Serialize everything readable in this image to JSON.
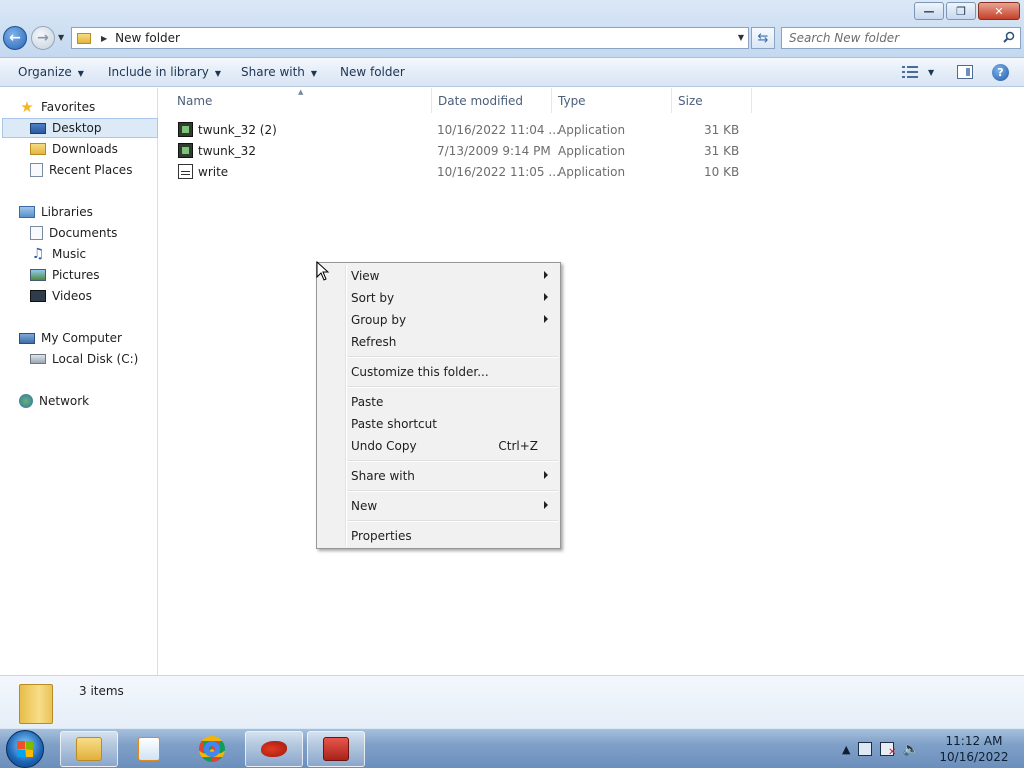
{
  "window": {
    "minimize_glyph": "—",
    "maximize_glyph": "❐",
    "close_glyph": "✕"
  },
  "address": {
    "path": "New folder",
    "search_placeholder": "Search New folder"
  },
  "toolbar": {
    "organize": "Organize",
    "include_in_library": "Include in library",
    "share_with": "Share with",
    "new_folder": "New folder",
    "help": "?"
  },
  "navpane": {
    "favorites": "Favorites",
    "desktop": "Desktop",
    "downloads": "Downloads",
    "recent_places": "Recent Places",
    "libraries": "Libraries",
    "documents": "Documents",
    "music": "Music",
    "pictures": "Pictures",
    "videos": "Videos",
    "my_computer": "My Computer",
    "local_disk": "Local Disk (C:)",
    "network": "Network"
  },
  "columns": {
    "name": "Name",
    "date_modified": "Date modified",
    "type": "Type",
    "size": "Size"
  },
  "files": [
    {
      "name": "twunk_32 (2)",
      "date": "10/16/2022 11:04 ...",
      "type": "Application",
      "size": "31 KB",
      "icon": "application-icon"
    },
    {
      "name": "twunk_32",
      "date": "7/13/2009 9:14 PM",
      "type": "Application",
      "size": "31 KB",
      "icon": "application-icon"
    },
    {
      "name": "write",
      "date": "10/16/2022 11:05 ...",
      "type": "Application",
      "size": "10 KB",
      "icon": "write-icon"
    }
  ],
  "context_menu": {
    "view": "View",
    "sort_by": "Sort by",
    "group_by": "Group by",
    "refresh": "Refresh",
    "customize": "Customize this folder...",
    "paste": "Paste",
    "paste_shortcut": "Paste shortcut",
    "undo_copy": "Undo Copy",
    "undo_copy_shortcut": "Ctrl+Z",
    "share_with": "Share with",
    "new": "New",
    "properties": "Properties"
  },
  "details": {
    "items_count": "3 items"
  },
  "taskbar": {
    "time": "11:12 AM",
    "date": "10/16/2022"
  },
  "colors": {
    "selection": "#dce9f7",
    "menu_bg": "#f1f1f1",
    "taskbar": "#7fa0c7"
  }
}
